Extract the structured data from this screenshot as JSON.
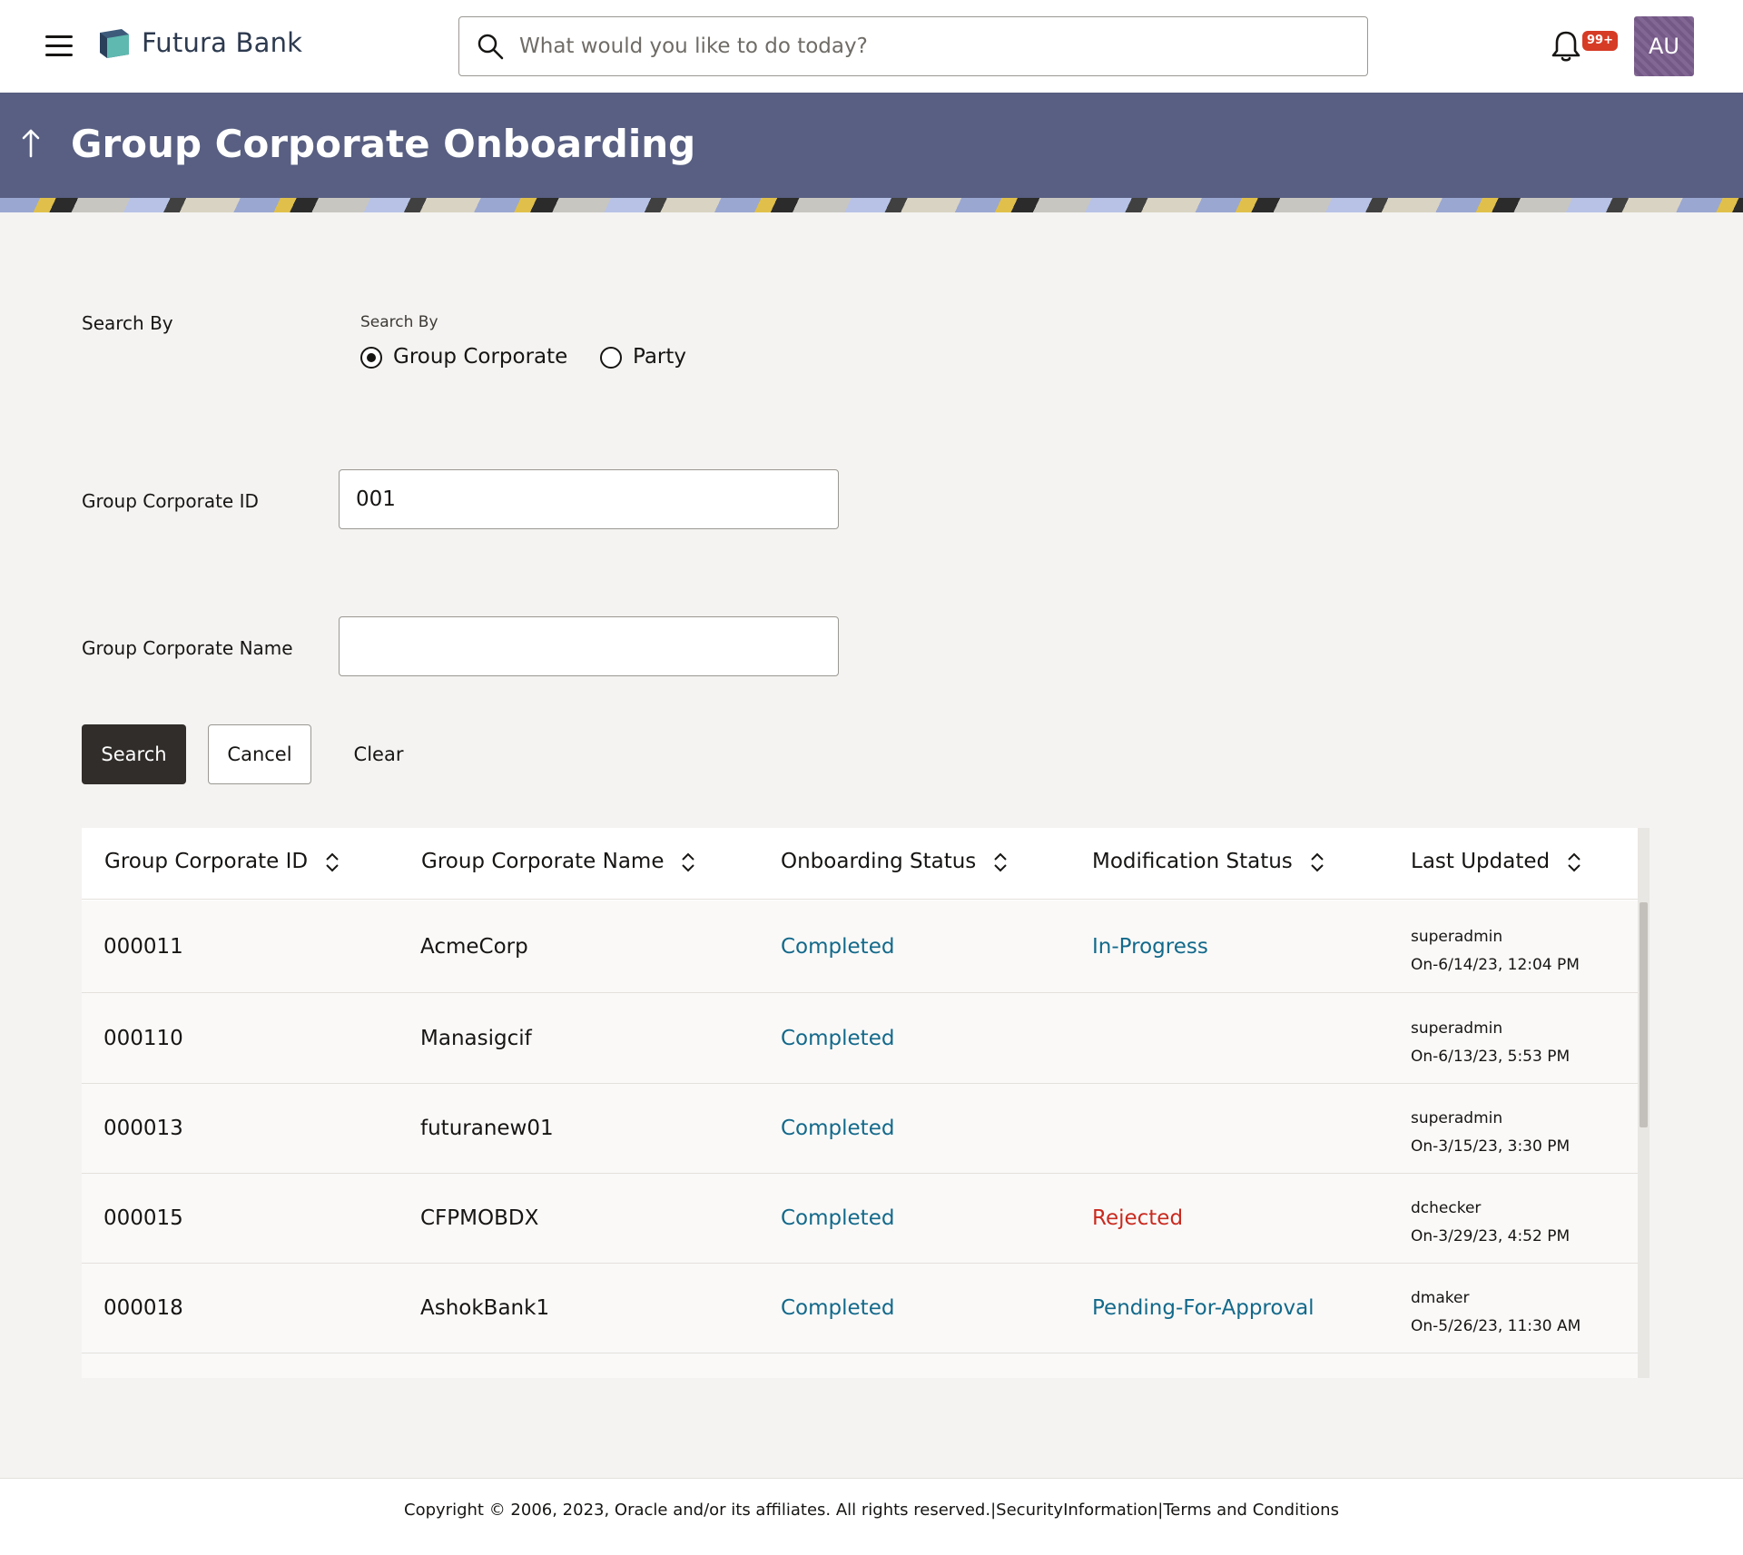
{
  "header": {
    "brand": "Futura Bank",
    "search_placeholder": "What would you like to do today?",
    "notification_badge": "99+",
    "avatar_initials": "AU"
  },
  "banner": {
    "title": "Group Corporate Onboarding"
  },
  "form": {
    "search_by_label": "Search By",
    "search_by_sublabel": "Search By",
    "radio_options": [
      {
        "label": "Group Corporate",
        "selected": true
      },
      {
        "label": "Party",
        "selected": false
      }
    ],
    "group_corporate_id_label": "Group Corporate ID",
    "group_corporate_id_value": "001",
    "group_corporate_name_label": "Group Corporate Name",
    "group_corporate_name_value": "",
    "buttons": {
      "search": "Search",
      "cancel": "Cancel",
      "clear": "Clear"
    }
  },
  "table": {
    "columns": [
      "Group Corporate ID",
      "Group Corporate Name",
      "Onboarding Status",
      "Modification Status",
      "Last Updated"
    ],
    "rows": [
      {
        "id": "000011",
        "name": "AcmeCorp",
        "onboarding": "Completed",
        "modification": "In-Progress",
        "updated_by": "superadmin",
        "updated_on": "On-6/14/23, 12:04 PM"
      },
      {
        "id": "000110",
        "name": "Manasigcif",
        "onboarding": "Completed",
        "modification": "",
        "updated_by": "superadmin",
        "updated_on": "On-6/13/23, 5:53 PM"
      },
      {
        "id": "000013",
        "name": "futuranew01",
        "onboarding": "Completed",
        "modification": "",
        "updated_by": "superadmin",
        "updated_on": "On-3/15/23, 3:30 PM"
      },
      {
        "id": "000015",
        "name": "CFPMOBDX",
        "onboarding": "Completed",
        "modification": "Rejected",
        "updated_by": "dchecker",
        "updated_on": "On-3/29/23, 4:52 PM"
      },
      {
        "id": "000018",
        "name": "AshokBank1",
        "onboarding": "Completed",
        "modification": "Pending-For-Approval",
        "updated_by": "dmaker",
        "updated_on": "On-5/26/23, 11:30 AM"
      }
    ]
  },
  "footer": {
    "copyright": "Copyright © 2006, 2023, Oracle and/or its affiliates. All rights reserved.",
    "sep1": "|",
    "security_link": "SecurityInformation",
    "sep2": "|",
    "terms_link": "Terms and Conditions"
  },
  "colors": {
    "banner": "#585f82",
    "link": "#13698a",
    "rejected": "#c92a1f",
    "primary_button": "#312d2a",
    "badge": "#d63b25"
  }
}
